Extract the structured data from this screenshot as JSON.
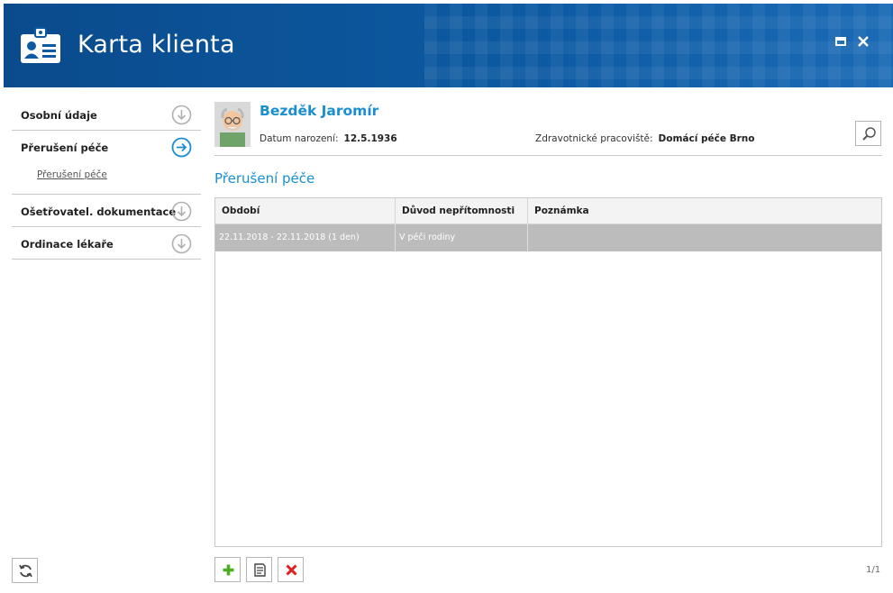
{
  "header": {
    "title": "Karta klienta",
    "icon": "id-card-icon",
    "colors": {
      "bg": "#0d5aa3",
      "accent": "#1a8fd0"
    }
  },
  "window": {
    "maximize_icon": "maximize-icon",
    "close_icon": "close-icon"
  },
  "sidebar": {
    "items": [
      {
        "label": "Osobní údaje",
        "icon": "arrow-down-circle-icon"
      },
      {
        "label": "Přerušení péče",
        "icon": "arrow-right-circle-icon",
        "active": true,
        "sub": [
          "Přerušení péče"
        ]
      },
      {
        "label": "Ošetřovatel. dokumentace",
        "icon": "arrow-down-circle-icon"
      },
      {
        "label": "Ordinace lékaře",
        "icon": "arrow-down-circle-icon"
      }
    ]
  },
  "client": {
    "name": "Bezděk Jaromír",
    "dob_label": "Datum narození:",
    "dob": "12.5.1936",
    "workplace_label": "Zdravotnické pracoviště:",
    "workplace": "Domácí péče Brno"
  },
  "section": {
    "title": "Přerušení péče"
  },
  "grid": {
    "columns": [
      "Období",
      "Důvod nepřítomnosti",
      "Poznámka"
    ],
    "rows": [
      [
        "22.11.2018 - 22.11.2018 (1 den)",
        "V péči rodiny",
        ""
      ]
    ]
  },
  "toolbar": {
    "add_icon": "plus-icon",
    "edit_icon": "document-icon",
    "delete_icon": "delete-x-icon"
  },
  "pager": "1/1"
}
